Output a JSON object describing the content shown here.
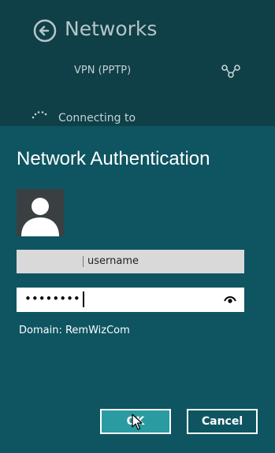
{
  "networks": {
    "title": "Networks",
    "back_icon": "back-arrow-circle-icon",
    "connection": {
      "name": "VPN (PPTP)",
      "icon": "vpn-link-icon",
      "status": "Connecting to"
    }
  },
  "auth": {
    "title": "Network Authentication",
    "avatar_icon": "user-avatar-icon",
    "username": {
      "placeholder": "username",
      "value": ""
    },
    "password": {
      "masked_value": "••••••••",
      "reveal_icon": "eye-icon"
    },
    "domain_label": "Domain: RemWizCom",
    "ok_label": "OK",
    "cancel_label": "Cancel"
  },
  "colors": {
    "background_top": "#0f3f47",
    "dialog_background": "#0e5561",
    "ok_button": "#2a9ba0",
    "text": "#ffffff"
  }
}
